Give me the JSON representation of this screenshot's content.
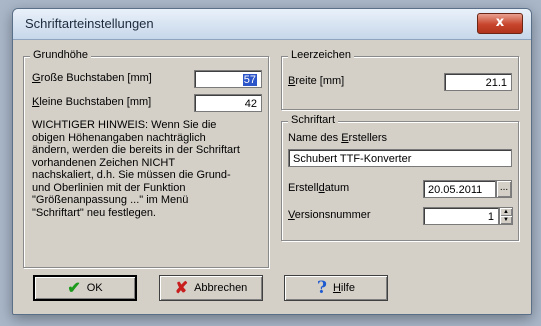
{
  "window": {
    "title": "Schriftarteinstellungen",
    "close_label": "x"
  },
  "grundhoehe": {
    "title": "Grundhöhe",
    "grosse_label_key": "G",
    "grosse_label_rest": "roße Buchstaben [mm]",
    "grosse_value": "57",
    "kleine_label_key": "K",
    "kleine_label_rest": "leine Buchstaben [mm]",
    "kleine_value": "42",
    "note_lines": [
      "WICHTIGER HINWEIS: Wenn Sie die",
      "obigen Höhenangaben nachträglich",
      "ändern, werden die bereits in der Schriftart",
      "vorhandenen Zeichen NICHT",
      "nachskaliert, d.h. Sie müssen die Grund-",
      "und Oberlinien mit der Funktion",
      "\"Größenanpassung ...\" im Menü",
      "\"Schriftart\" neu festlegen."
    ]
  },
  "leerzeichen": {
    "title": "Leerzeichen",
    "breite_label_key": "B",
    "breite_label_rest": "reite [mm]",
    "breite_value": "21.1"
  },
  "schriftart": {
    "title": "Schriftart",
    "ersteller_label_pre": "Name des ",
    "ersteller_label_key": "E",
    "ersteller_label_rest": "rstellers",
    "ersteller_value": "Schubert TTF-Konverter",
    "datum_label_pre": "Erstell",
    "datum_label_key": "d",
    "datum_label_rest": "atum",
    "datum_value": "20.05.2011",
    "datum_button": "...",
    "version_label_key": "V",
    "version_label_rest": "ersionsnummer",
    "version_value": "1"
  },
  "buttons": {
    "ok_label": "OK",
    "cancel_label": "Abbrechen",
    "help_key": "H",
    "help_rest": "ilfe"
  },
  "icons": {
    "ok": "check-icon",
    "cancel": "x-icon",
    "help": "question-icon"
  }
}
